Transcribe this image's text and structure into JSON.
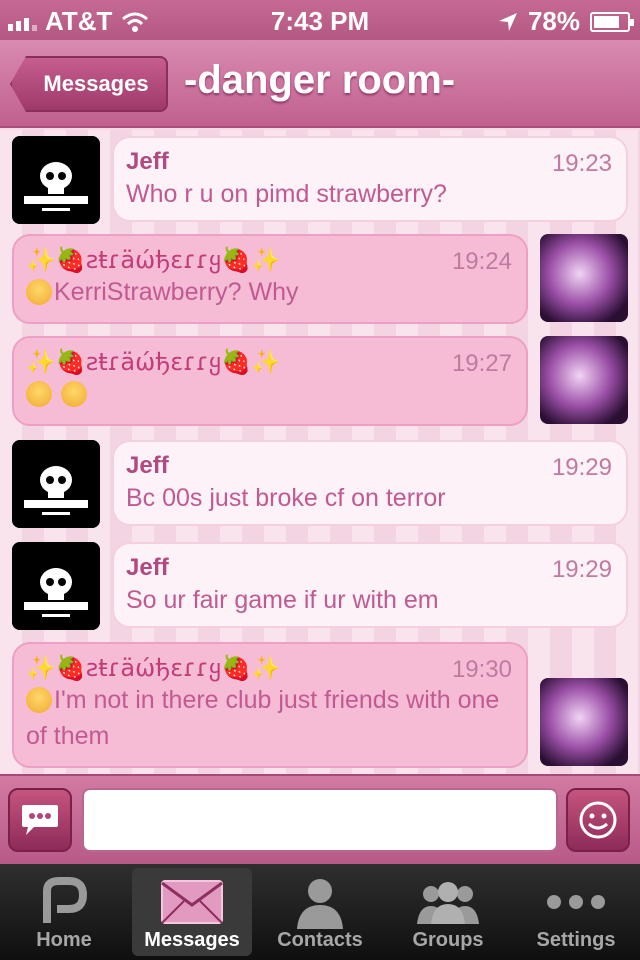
{
  "status_bar": {
    "carrier": "AT&T",
    "time": "7:43 PM",
    "battery": "78%",
    "battery_level": 0.78
  },
  "nav": {
    "back_label": "Messages",
    "title": "-danger room-"
  },
  "messages": [
    {
      "sender": "Jeff",
      "time": "19:23",
      "text": "Who r u on pimd strawberry?",
      "side": "left"
    },
    {
      "sender": "✨🍓ƨŧɾäώђɛɾɾყ🍓✨",
      "time": "19:24",
      "text": "KerriStrawberry? Why",
      "side": "right"
    },
    {
      "sender": "✨🍓ƨŧɾäώђɛɾɾყ🍓✨",
      "time": "19:27",
      "text": "",
      "side": "right"
    },
    {
      "sender": "Jeff",
      "time": "19:29",
      "text": "Bc 00s just broke cf on terror",
      "side": "left"
    },
    {
      "sender": "Jeff",
      "time": "19:29",
      "text": "So ur fair game if ur with em",
      "side": "left"
    },
    {
      "sender": "✨🍓ƨŧɾäώђɛɾɾყ🍓✨",
      "time": "19:30",
      "text": "I'm not in there club just friends with one of them",
      "side": "right"
    }
  ],
  "input": {
    "value": "",
    "placeholder": ""
  },
  "tabs": [
    {
      "label": "Home"
    },
    {
      "label": "Messages"
    },
    {
      "label": "Contacts"
    },
    {
      "label": "Groups"
    },
    {
      "label": "Settings"
    }
  ],
  "colors": {
    "accent": "#c0608f",
    "bubble_pink": "#f6bcd6",
    "text_pink": "#c05b92"
  }
}
